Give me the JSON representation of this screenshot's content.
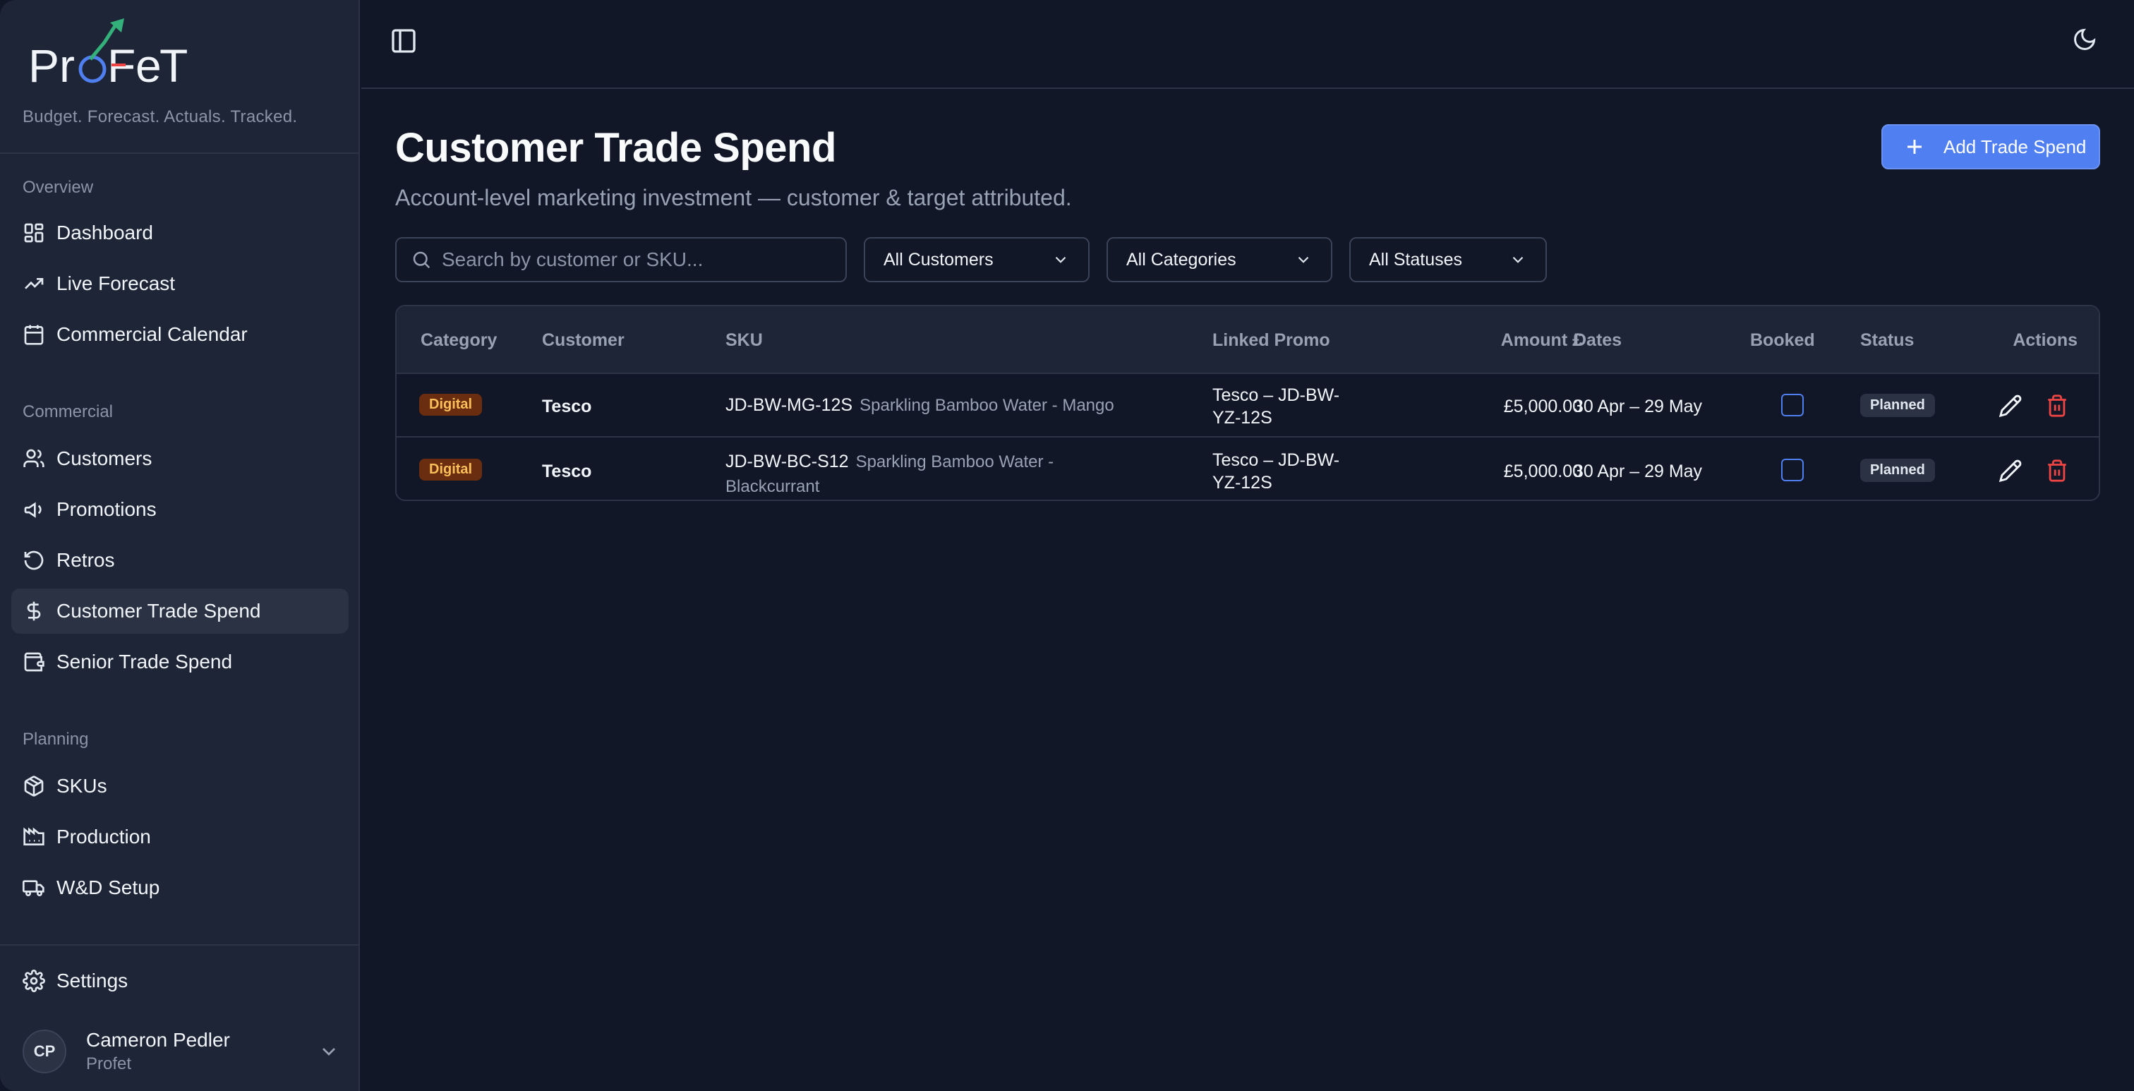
{
  "brand": {
    "logo_text": "ProFeT",
    "tagline": "Budget. Forecast. Actuals. Tracked.",
    "accent_color": "#4f7ff0",
    "arrow_color": "#34b07a"
  },
  "sidebar": {
    "sections": [
      {
        "label": "Overview",
        "items": [
          {
            "label": "Dashboard",
            "icon": "dashboard-icon"
          },
          {
            "label": "Live Forecast",
            "icon": "trend-up-icon"
          },
          {
            "label": "Commercial Calendar",
            "icon": "calendar-icon"
          }
        ]
      },
      {
        "label": "Commercial",
        "items": [
          {
            "label": "Customers",
            "icon": "users-icon"
          },
          {
            "label": "Promotions",
            "icon": "megaphone-icon"
          },
          {
            "label": "Retros",
            "icon": "rotate-ccw-icon"
          },
          {
            "label": "Customer Trade Spend",
            "icon": "dollar-icon",
            "active": true
          },
          {
            "label": "Senior Trade Spend",
            "icon": "wallet-icon"
          }
        ]
      },
      {
        "label": "Planning",
        "items": [
          {
            "label": "SKUs",
            "icon": "package-icon"
          },
          {
            "label": "Production",
            "icon": "factory-icon"
          },
          {
            "label": "W&D Setup",
            "icon": "truck-icon"
          }
        ]
      }
    ],
    "settings_label": "Settings",
    "user": {
      "initials": "CP",
      "name": "Cameron Pedler",
      "org": "Profet"
    }
  },
  "page": {
    "title": "Customer Trade Spend",
    "subtitle": "Account-level marketing investment — customer & target attributed.",
    "add_button": "Add Trade Spend"
  },
  "filters": {
    "search_placeholder": "Search by customer or SKU...",
    "customers": "All Customers",
    "categories": "All Categories",
    "statuses": "All Statuses"
  },
  "table": {
    "columns": [
      "Category",
      "Customer",
      "SKU",
      "Linked Promo",
      "Amount £",
      "Dates",
      "Booked",
      "Status",
      "Actions"
    ],
    "rows": [
      {
        "category": "Digital",
        "customer": "Tesco",
        "sku_code": "JD-BW-MG-12S",
        "sku_name": "Sparkling Bamboo Water - Mango",
        "promo": "Tesco – JD-BW-YZ-12S",
        "amount": "£5,000.00",
        "dates": "30 Apr – 29 May",
        "booked": false,
        "status": "Planned"
      },
      {
        "category": "Digital",
        "customer": "Tesco",
        "sku_code": "JD-BW-BC-S12",
        "sku_name": "Sparkling Bamboo Water - Blackcurrant",
        "promo": "Tesco – JD-BW-YZ-12S",
        "amount": "£5,000.00",
        "dates": "30 Apr – 29 May",
        "booked": false,
        "status": "Planned"
      }
    ]
  }
}
